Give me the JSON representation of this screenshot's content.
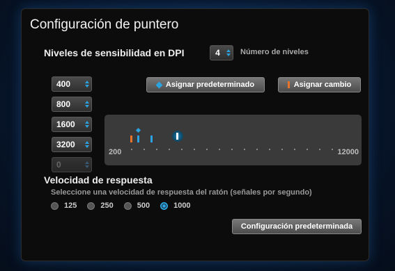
{
  "title": "Configuración de puntero",
  "dpi": {
    "heading": "Niveles de sensibilidad en DPI",
    "num_levels_value": "4",
    "num_levels_label": "Número de niveles",
    "levels": [
      "400",
      "800",
      "1600",
      "3200",
      "0"
    ]
  },
  "buttons": {
    "assign_default": "Asignar predeterminado",
    "assign_change": "Asignar cambio",
    "default_config": "Configuración predeterminada"
  },
  "slider": {
    "min": "200",
    "max": "12000",
    "colors": {
      "orange": "#e8732a",
      "blue": "#2aa3e0"
    }
  },
  "report_rate": {
    "heading": "Velocidad de respuesta",
    "description": "Seleccione una velocidad de respuesta del ratón (señales por segundo)",
    "options": [
      "125",
      "250",
      "500",
      "1000"
    ],
    "selected": "1000"
  }
}
